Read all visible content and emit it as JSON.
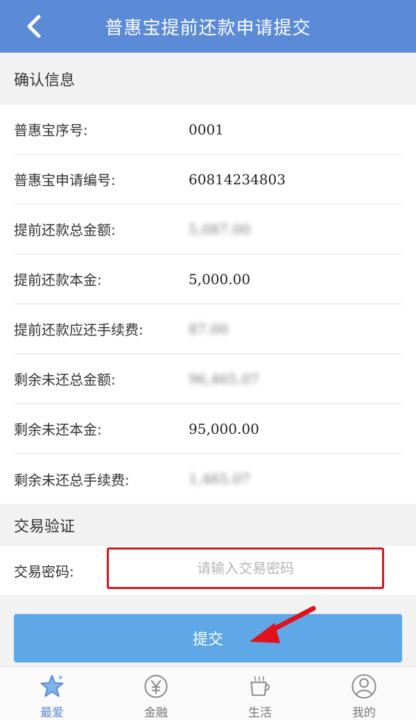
{
  "header": {
    "title": "普惠宝提前还款申请提交"
  },
  "confirm_section": {
    "title": "确认信息",
    "rows": [
      {
        "label": "普惠宝序号:",
        "value": "0001",
        "blurred": false
      },
      {
        "label": "普惠宝申请编号:",
        "value": "60814234803",
        "blurred": false
      },
      {
        "label": "提前还款总金额:",
        "value": "5,087.00",
        "blurred": true
      },
      {
        "label": "提前还款本金:",
        "value": "5,000.00",
        "blurred": false
      },
      {
        "label": "提前还款应还手续费:",
        "value": "87.00",
        "blurred": true
      },
      {
        "label": "剩余未还总金额:",
        "value": "96,465.07",
        "blurred": true
      },
      {
        "label": "剩余未还本金:",
        "value": "95,000.00",
        "blurred": false
      },
      {
        "label": "剩余未还总手续费:",
        "value": "1,465.07",
        "blurred": true
      }
    ]
  },
  "verify_section": {
    "title": "交易验证",
    "password_label": "交易密码:",
    "password_placeholder": "请输入交易密码",
    "password_value": ""
  },
  "submit": {
    "label": "提交"
  },
  "colors": {
    "header_bg": "#5b8ad6",
    "submit_bg": "#5fa8e8",
    "highlight_border": "#e0121b",
    "arrow": "#e0121b",
    "tab_active": "#5b8ad6"
  },
  "tabbar": {
    "tabs": [
      {
        "label": "最爱",
        "icon": "star-icon",
        "active": true
      },
      {
        "label": "金融",
        "icon": "yuan-icon",
        "active": false
      },
      {
        "label": "生活",
        "icon": "coffee-cup-icon",
        "active": false
      },
      {
        "label": "我的",
        "icon": "user-icon",
        "active": false
      }
    ]
  }
}
